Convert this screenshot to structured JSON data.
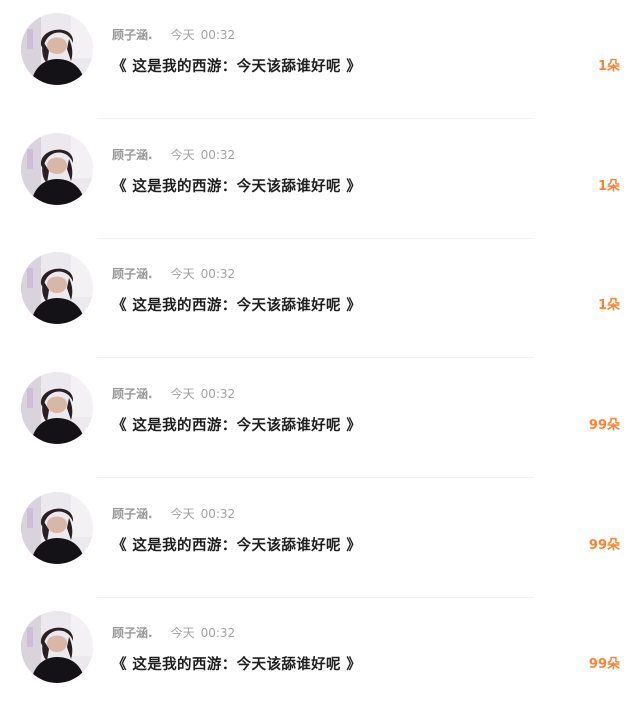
{
  "messages": [
    {
      "name": "顾子涵.",
      "date": "今天",
      "time": "00:32",
      "text": "《 这是我的西游：今天该舔谁好呢 》",
      "count": "1朵"
    },
    {
      "name": "顾子涵.",
      "date": "今天",
      "time": "00:32",
      "text": "《 这是我的西游：今天该舔谁好呢 》",
      "count": "1朵"
    },
    {
      "name": "顾子涵.",
      "date": "今天",
      "time": "00:32",
      "text": "《 这是我的西游：今天该舔谁好呢 》",
      "count": "1朵"
    },
    {
      "name": "顾子涵.",
      "date": "今天",
      "time": "00:32",
      "text": "《 这是我的西游：今天该舔谁好呢 》",
      "count": "99朵"
    },
    {
      "name": "顾子涵.",
      "date": "今天",
      "time": "00:32",
      "text": "《 这是我的西游：今天该舔谁好呢 》",
      "count": "99朵"
    },
    {
      "name": "顾子涵.",
      "date": "今天",
      "time": "00:32",
      "text": "《 这是我的西游：今天该舔谁好呢 》",
      "count": "99朵"
    }
  ],
  "colors": {
    "accent": "#ff8330",
    "meta": "#a3a3a3",
    "text": "#1f1f1f",
    "divider": "#f1f1f1"
  }
}
